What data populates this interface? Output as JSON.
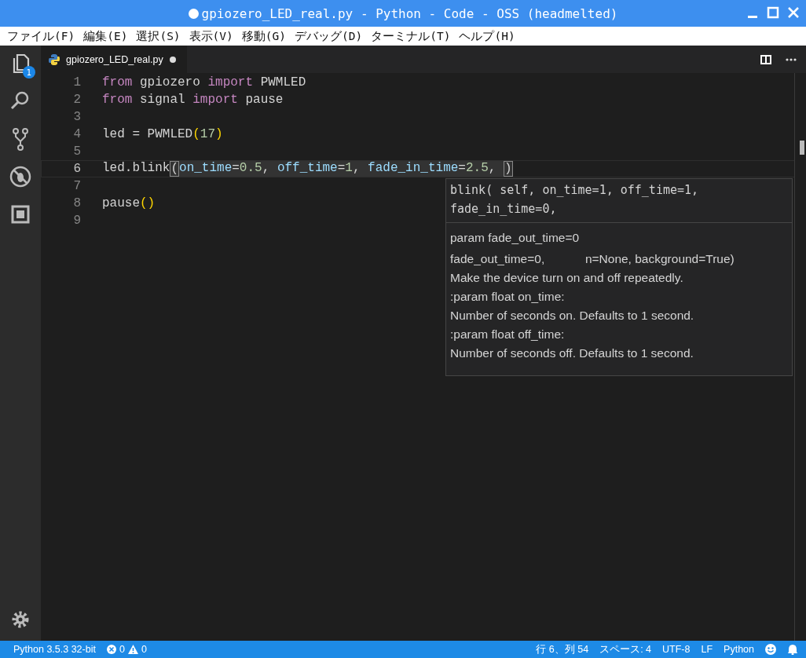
{
  "window": {
    "title": "gpiozero_LED_real.py - Python - Code - OSS (headmelted)",
    "dirty": true
  },
  "menu": [
    "ファイル(F)",
    "編集(E)",
    "選択(S)",
    "表示(V)",
    "移動(G)",
    "デバッグ(D)",
    "ターミナル(T)",
    "ヘルプ(H)"
  ],
  "activity_bar": {
    "explorer_badge": "1"
  },
  "tabs": [
    {
      "label": "gpiozero_LED_real.py",
      "selected": true,
      "dirty": true
    }
  ],
  "editor": {
    "lines": [
      {
        "number": "1",
        "current": false,
        "tokens": [
          {
            "kind": "keyword",
            "text": "from"
          },
          {
            "kind": "plain",
            "text": " gpiozero "
          },
          {
            "kind": "keyword",
            "text": "import"
          },
          {
            "kind": "plain",
            "text": " PWMLED"
          }
        ]
      },
      {
        "number": "2",
        "current": false,
        "tokens": [
          {
            "kind": "keyword",
            "text": "from"
          },
          {
            "kind": "plain",
            "text": " signal "
          },
          {
            "kind": "keyword",
            "text": "import"
          },
          {
            "kind": "plain",
            "text": " pause"
          }
        ]
      },
      {
        "number": "3",
        "current": false
      },
      {
        "number": "4",
        "current": false,
        "tokens": [
          {
            "kind": "plain",
            "text": "led = PWMLED"
          },
          {
            "kind": "bracket",
            "text": "("
          },
          {
            "kind": "number",
            "text": "17"
          },
          {
            "kind": "bracket",
            "text": ")"
          }
        ]
      },
      {
        "number": "5",
        "current": false
      },
      {
        "number": "6",
        "current": true,
        "tokens": [
          {
            "kind": "plain",
            "text": "led.blink"
          },
          {
            "kind": "match",
            "text": "("
          },
          {
            "kind": "param",
            "text": "on_time"
          },
          {
            "kind": "plainsel",
            "text": "="
          },
          {
            "kind": "number",
            "text": "0.5"
          },
          {
            "kind": "plainsel",
            "text": ", "
          },
          {
            "kind": "param",
            "text": "off_time"
          },
          {
            "kind": "plainsel",
            "text": "="
          },
          {
            "kind": "number",
            "text": "1"
          },
          {
            "kind": "plainsel",
            "text": ", "
          },
          {
            "kind": "param",
            "text": "fade_in_time"
          },
          {
            "kind": "plainsel",
            "text": "="
          },
          {
            "kind": "number",
            "text": "2.5"
          },
          {
            "kind": "plainsel",
            "text": ", "
          },
          {
            "kind": "match",
            "text": ")"
          }
        ]
      },
      {
        "number": "7",
        "current": false
      },
      {
        "number": "8",
        "current": false,
        "tokens": [
          {
            "kind": "plain",
            "text": "pause"
          },
          {
            "kind": "bracket",
            "text": "()"
          }
        ]
      },
      {
        "number": "9",
        "current": false
      }
    ]
  },
  "signature_help": {
    "signature": [
      "blink( self, on_time=1, off_time=1,",
      "fade_in_time=0,"
    ],
    "param": "param fade_out_time=0",
    "doc": [
      "fade_out_time=0,            n=None, background=True)",
      "Make the device turn on and off repeatedly.",
      ":param float on_time:",
      "Number of seconds on. Defaults to 1 second.",
      ":param float off_time:",
      "Number of seconds off. Defaults to 1 second."
    ]
  },
  "status_bar": {
    "interpreter": "Python 3.5.3 32-bit",
    "errors": "0",
    "warnings": "0",
    "position": "行 6、列 54",
    "indent": "スペース: 4",
    "encoding": "UTF-8",
    "eol": "LF",
    "language": "Python"
  }
}
